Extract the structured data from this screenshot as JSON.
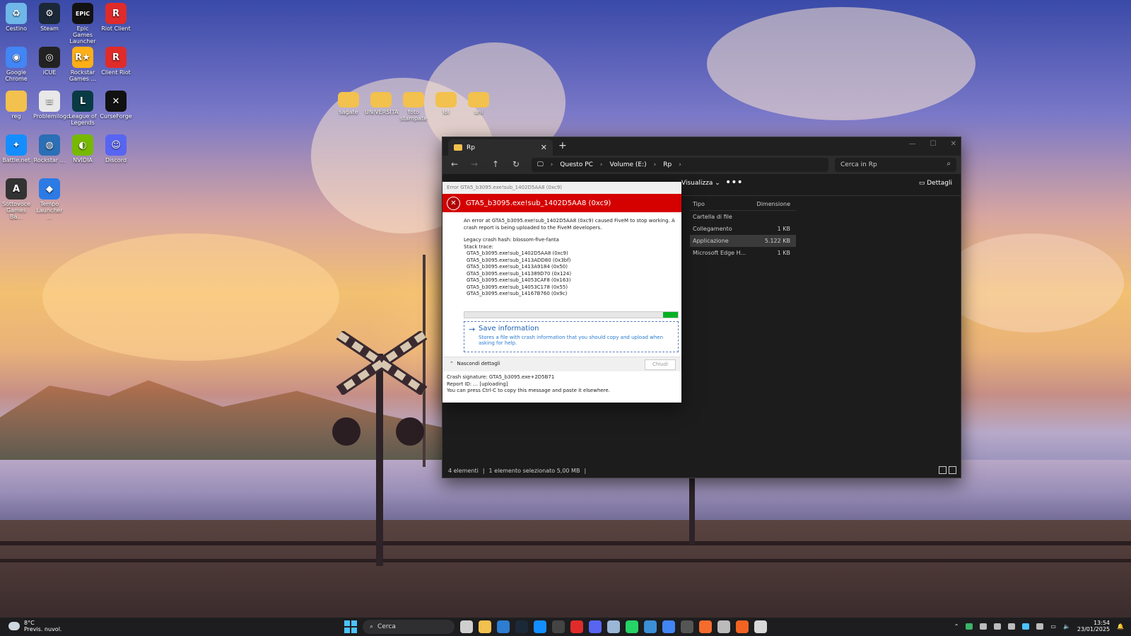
{
  "desktop": {
    "icons": [
      {
        "label": "Cestino",
        "icon": "recycle-bin-icon",
        "color": "#6fb7e8",
        "glyph": "♻"
      },
      {
        "label": "Steam",
        "icon": "steam-icon",
        "color": "#1b2838",
        "glyph": "⚙"
      },
      {
        "label": "Epic Games Launcher",
        "icon": "epic-games-icon",
        "color": "#121212",
        "glyph": "EPIC"
      },
      {
        "label": "Riot Client",
        "icon": "riot-client-icon",
        "color": "#e02b2b",
        "glyph": "R"
      },
      {
        "label": "Google Chrome",
        "icon": "chrome-icon",
        "color": "#4285f4",
        "glyph": "◉"
      },
      {
        "label": "iCUE",
        "icon": "icue-icon",
        "color": "#222222",
        "glyph": "◎"
      },
      {
        "label": "Rockstar Games ...",
        "icon": "rockstar-icon",
        "color": "#fcaf17",
        "glyph": "R★"
      },
      {
        "label": "Client Riot",
        "icon": "riot-client-icon",
        "color": "#e02b2b",
        "glyph": "R"
      },
      {
        "label": "reg",
        "icon": "folder-icon",
        "color": "#f2c14e",
        "glyph": ""
      },
      {
        "label": "Problemilogo",
        "icon": "text-file-icon",
        "color": "#e8e8e8",
        "glyph": "≡"
      },
      {
        "label": "League of Legends",
        "icon": "league-icon",
        "color": "#0a3b44",
        "glyph": "L"
      },
      {
        "label": "CurseForge",
        "icon": "curseforge-icon",
        "color": "#111111",
        "glyph": "✕"
      },
      {
        "label": "Battle.net",
        "icon": "battlenet-icon",
        "color": "#148eff",
        "glyph": "✦"
      },
      {
        "label": "Rockstar ...",
        "icon": "rockstar-icon",
        "color": "#2b6fb6",
        "glyph": "◍"
      },
      {
        "label": "NVIDIA",
        "icon": "nvidia-icon",
        "color": "#76b900",
        "glyph": "◐"
      },
      {
        "label": "Discord",
        "icon": "discord-icon",
        "color": "#5865f2",
        "glyph": "☺"
      },
      {
        "label": "Sottovoce Games Ba...",
        "icon": "app-icon",
        "color": "#333333",
        "glyph": "A"
      },
      {
        "label": "Tempo Launcher ...",
        "icon": "launcher-icon",
        "color": "#2c7be5",
        "glyph": "◆"
      }
    ],
    "center_icons": [
      {
        "label": "sagate",
        "icon": "folder-icon"
      },
      {
        "label": "UNIVERSITA",
        "icon": "folder-icon"
      },
      {
        "label": "foto stampate",
        "icon": "folder-icon"
      },
      {
        "label": "lol",
        "icon": "folder-icon"
      },
      {
        "label": "uni",
        "icon": "folder-icon"
      }
    ]
  },
  "explorer": {
    "tab_title": "Rp",
    "breadcrumb": [
      "Questo PC",
      "Volume (E:)",
      "Rp"
    ],
    "search_placeholder": "Cerca in Rp",
    "toolbar": {
      "view": "Visualizza",
      "more": "•••",
      "details": "Dettagli"
    },
    "columns": {
      "type": "Tipo",
      "size": "Dimensione"
    },
    "rows": [
      {
        "type": "Cartella di file",
        "size": ""
      },
      {
        "type": "Collegamento",
        "size": "1 KB"
      },
      {
        "type": "Applicazione",
        "size": "5.122 KB"
      },
      {
        "type": "Microsoft Edge H...",
        "size": "1 KB"
      }
    ],
    "status": {
      "count": "4 elementi",
      "selected": "1 elemento selezionato 5,00 MB"
    }
  },
  "error_dialog": {
    "caption": "Error GTA5_b3095.exe!sub_1402D5AA8 (0xc9)",
    "title": "GTA5_b3095.exe!sub_1402D5AA8 (0xc9)",
    "message": "An error at GTA5_b3095.exe!sub_1402D5AA8 (0xc9) caused FiveM to stop working. A crash report is being uploaded to the FiveM developers.",
    "legacy_hash": "Legacy crash hash: blossom-five-fanta",
    "stack_label": "Stack trace:",
    "stack": [
      "GTA5_b3095.exe!sub_1402D5AA8 (0xc9)",
      "GTA5_b3095.exe!sub_1413ADD80 (0x3bf)",
      "GTA5_b3095.exe!sub_1413A9184 (0x50)",
      "GTA5_b3095.exe!sub_141389D70 (0x124)",
      "GTA5_b3095.exe!sub_14053CAF8 (0x163)",
      "GTA5_b3095.exe!sub_14053C178 (0x55)",
      "GTA5_b3095.exe!sub_14167B760 (0x9c)"
    ],
    "progress_fraction": 0.07,
    "save_title": "Save information",
    "save_desc": "Stores a file with crash information that you should copy and upload when asking for help.",
    "hide_details": "Nascondi dettagli",
    "close_label": "Chiudi",
    "signature": "Crash signature: GTA5_b3095.exe+2D5B71",
    "report_id": "Report ID: ... [uploading]",
    "copy_hint": "You can press Ctrl-C to copy this message and paste it elsewhere."
  },
  "taskbar": {
    "weather_temp": "8°C",
    "weather_desc": "Previs. nuvol.",
    "search_label": "Cerca",
    "time": "13:54",
    "date": "23/01/2025",
    "apps": [
      {
        "icon": "task-view-icon",
        "color": "#cfcfcf"
      },
      {
        "icon": "file-explorer-icon",
        "color": "#f2c14e"
      },
      {
        "icon": "store-icon",
        "color": "#2d7dd2"
      },
      {
        "icon": "steam-icon",
        "color": "#1b2838"
      },
      {
        "icon": "battlenet-icon",
        "color": "#148eff"
      },
      {
        "icon": "epic-games-icon",
        "color": "#444444"
      },
      {
        "icon": "riot-client-icon",
        "color": "#e02b2b"
      },
      {
        "icon": "discord-icon",
        "color": "#5865f2"
      },
      {
        "icon": "photos-icon",
        "color": "#9ab7d8"
      },
      {
        "icon": "whatsapp-icon",
        "color": "#25d366"
      },
      {
        "icon": "mail-icon",
        "color": "#3b8fd6"
      },
      {
        "icon": "chrome-icon",
        "color": "#4285f4"
      },
      {
        "icon": "icue-icon",
        "color": "#555555"
      },
      {
        "icon": "origin-icon",
        "color": "#f56c2d"
      },
      {
        "icon": "notepad-icon",
        "color": "#bbbbbb"
      },
      {
        "icon": "fivem-icon",
        "color": "#f26322"
      },
      {
        "icon": "rockstar-icon",
        "color": "#d8d8d8"
      }
    ]
  }
}
